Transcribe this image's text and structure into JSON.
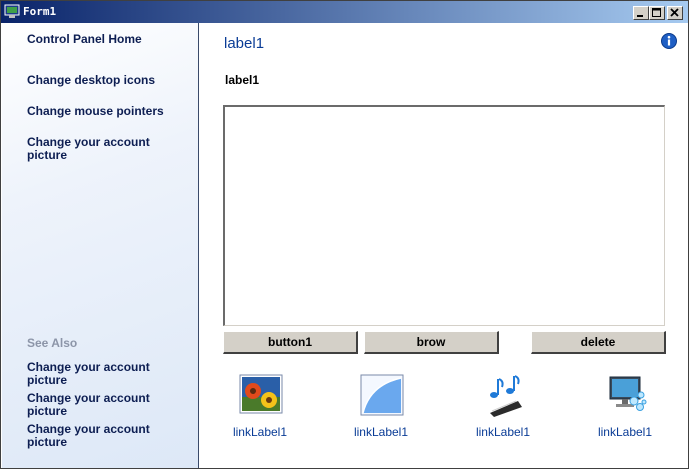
{
  "window": {
    "title": "Form1",
    "controls": {
      "minimize": "minimize",
      "maximize": "maximize",
      "close": "close"
    }
  },
  "sidebar": {
    "home": "Control Panel Home",
    "links": [
      "Change desktop icons",
      "Change mouse pointers",
      "Change your account picture"
    ],
    "see_also_heading": "See Also",
    "see_also_links": [
      "Change your account picture",
      "Change your account picture",
      "Change your account picture"
    ]
  },
  "main": {
    "title": "label1",
    "subtitle": "label1",
    "textarea_value": "",
    "buttons": {
      "button1": "button1",
      "brow": "brow",
      "delete": "delete"
    },
    "tiles": [
      {
        "icon": "flower-photo-icon",
        "label": "linkLabel1"
      },
      {
        "icon": "blank-blue-picture-icon",
        "label": "linkLabel1"
      },
      {
        "icon": "music-notes-icon",
        "label": "linkLabel1"
      },
      {
        "icon": "monitor-bubbles-icon",
        "label": "linkLabel1"
      }
    ]
  },
  "colors": {
    "titlebar_start": "#0a246a",
    "titlebar_end": "#a6caf0",
    "link_blue": "#0a3c96",
    "sidebar_text": "#0d1e52",
    "see_also_gray": "#8c95a8"
  }
}
